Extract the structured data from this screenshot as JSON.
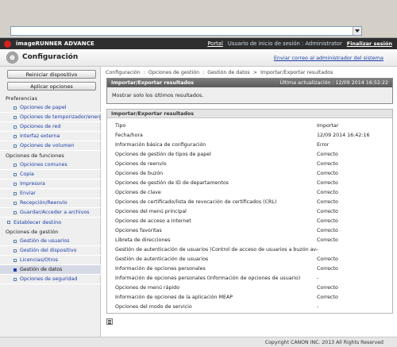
{
  "brand": {
    "name": "imageRUNNER ADVANCE"
  },
  "topbar": {
    "portal": "Portal",
    "user": "Usuario de inicio de sesión : Administrator",
    "logout": "Finalizar sesión"
  },
  "header": {
    "title": "Configuración",
    "mail_link": "Enviar correo al administrador del sistema"
  },
  "sidebar": {
    "restart_button": "Reiniciar dispositivo",
    "apply_button": "Aplicar opciones",
    "sections": [
      {
        "label": "Preferencias",
        "items": [
          {
            "label": "Opciones de papel"
          },
          {
            "label": "Opciones de temporizador/energía"
          },
          {
            "label": "Opciones de red"
          },
          {
            "label": "Interfaz externa"
          },
          {
            "label": "Opciones de volumen"
          }
        ]
      },
      {
        "label": "Opciones de funciones",
        "items": [
          {
            "label": "Opciones comunes"
          },
          {
            "label": "Copia"
          },
          {
            "label": "Impresora"
          },
          {
            "label": "Enviar"
          },
          {
            "label": "Recepción/Reenvío"
          },
          {
            "label": "Guardar/Acceder a archivos"
          }
        ]
      },
      {
        "label": "Establecer destino",
        "items": []
      },
      {
        "label": "Opciones de gestión",
        "items": [
          {
            "label": "Gestión de usuarios"
          },
          {
            "label": "Gestión del dispositivo"
          },
          {
            "label": "Licencias/Otros"
          },
          {
            "label": "Gestión de datos"
          },
          {
            "label": "Opciones de seguridad"
          }
        ]
      }
    ]
  },
  "breadcrumb": {
    "items": [
      "Configuración",
      "Opciones de gestión",
      "Gestión de datos",
      "Importar/Exportar resultados"
    ],
    "sep1": ":",
    "sep2": ">"
  },
  "panel1": {
    "title": "Importar/Exportar resultados",
    "updated": "Última actualización : 12/09 2014 16:52:22",
    "message": "Mostrar solo los últimos resultados."
  },
  "panel2": {
    "title": "Importar/Exportar resultados",
    "rows": [
      {
        "k": "Tipo",
        "v": "Importar"
      },
      {
        "k": "Fecha/hora",
        "v": "12/09 2014 16:42:16"
      },
      {
        "k": "Información básica de configuración",
        "v": "Error"
      },
      {
        "k": "Opciones de gestión de tipos de papel",
        "v": "Correcto"
      },
      {
        "k": "Opciones de reenvío",
        "v": "Correcto"
      },
      {
        "k": "Opciones de buzón",
        "v": "Correcto"
      },
      {
        "k": "Opciones de gestión de ID de departamentos",
        "v": "Correcto"
      },
      {
        "k": "Opciones de clave",
        "v": "Correcto"
      },
      {
        "k": "Opciones de certificado/lista de revocación de certificados (CRL)",
        "v": "Correcto"
      },
      {
        "k": "Opciones del menú principal",
        "v": "Correcto"
      },
      {
        "k": "Opciones de acceso a Internet",
        "v": "Correcto"
      },
      {
        "k": "Opciones favoritas",
        "v": "Correcto"
      },
      {
        "k": "Libreta de direcciones",
        "v": "Correcto"
      },
      {
        "k": "Gestión de autenticación de usuarios (Control de acceso de usuarios a buzón avanzado)",
        "v": "-"
      },
      {
        "k": "Gestión de autenticación de usuarios",
        "v": "Correcto"
      },
      {
        "k": "Información de opciones personales",
        "v": "Correcto"
      },
      {
        "k": "Información de opciones personales (Información de opciones de usuario)",
        "v": "-"
      },
      {
        "k": "Opciones de menú rápido",
        "v": "Correcto"
      },
      {
        "k": "Información de opciones de la aplicación MEAP",
        "v": "Correcto"
      },
      {
        "k": "Opciones del modo de servicio",
        "v": "-"
      }
    ]
  },
  "footer": {
    "copyright": "Copyright CANON INC. 2013 All Rights Reserved"
  },
  "colors": {
    "link": "#1a3fa8",
    "brandbar": "#2e2e2e",
    "panel_head": "#5a5a5a"
  }
}
